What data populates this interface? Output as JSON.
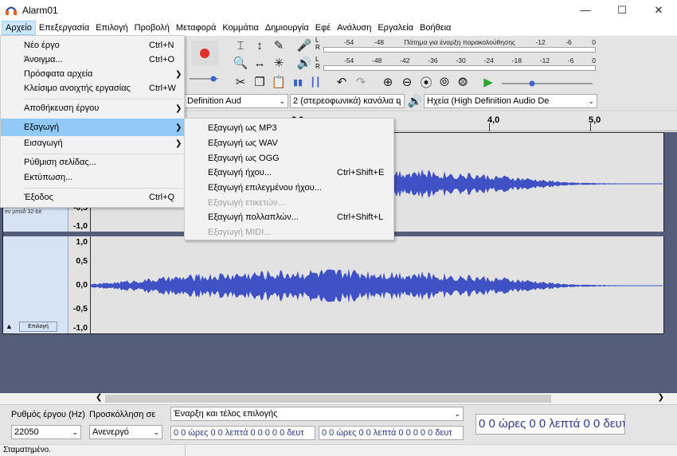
{
  "window": {
    "title": "Alarm01"
  },
  "menubar": [
    "Αρχείο",
    "Επεξεργασία",
    "Επιλογή",
    "Προβολή",
    "Μεταφορά",
    "Κομμάτια",
    "Δημιουργία",
    "Εφέ",
    "Ανάλυση",
    "Εργαλεία",
    "Βοήθεια"
  ],
  "file_menu": [
    {
      "label": "Νέο έργο",
      "shortcut": "Ctrl+N"
    },
    {
      "label": "Άνοιγμα...",
      "shortcut": "Ctrl+O"
    },
    {
      "label": "Πρόσφατα αρχεία",
      "shortcut": "",
      "submenu": true
    },
    {
      "label": "Κλείσιμο ανοιχτής εργασίας",
      "shortcut": "Ctrl+W"
    },
    {
      "label": "Αποθήκευση έργου",
      "shortcut": "",
      "submenu": true
    },
    {
      "label": "Εξαγωγή",
      "shortcut": "",
      "submenu": true
    },
    {
      "label": "Εισαγωγή",
      "shortcut": "",
      "submenu": true
    },
    {
      "label": "Ρύθμιση σελίδας...",
      "shortcut": ""
    },
    {
      "label": "Εκτύπωση...",
      "shortcut": ""
    },
    {
      "label": "Έξοδος",
      "shortcut": "Ctrl+Q"
    }
  ],
  "export_menu": [
    {
      "label": "Εξαγωγή ως MP3",
      "shortcut": "",
      "disabled": false
    },
    {
      "label": "Εξαγωγή ως WAV",
      "shortcut": "",
      "disabled": false
    },
    {
      "label": "Εξαγωγή ως OGG",
      "shortcut": "",
      "disabled": false
    },
    {
      "label": "Εξαγωγή ήχου...",
      "shortcut": "Ctrl+Shift+E",
      "disabled": false
    },
    {
      "label": "Εξαγωγή επιλεγμένου ήχου...",
      "shortcut": "",
      "disabled": false
    },
    {
      "label": "Εξαγωγή ετικετών...",
      "shortcut": "",
      "disabled": true
    },
    {
      "label": "Εξαγωγή πολλαπλών...",
      "shortcut": "Ctrl+Shift+L",
      "disabled": false
    },
    {
      "label": "Εξαγωγή MIDI...",
      "shortcut": "",
      "disabled": true
    }
  ],
  "meters": {
    "record_scale": [
      "-54",
      "-48",
      "Πάτημα για έναρξη παρακολούθησης",
      "-12",
      "-6",
      "0"
    ],
    "playback_scale": [
      "-54",
      "-48",
      "-42",
      "-36",
      "-30",
      "-24",
      "-18",
      "-12",
      "-6",
      "0"
    ],
    "lr": [
      "L",
      "R"
    ]
  },
  "device": {
    "host_partial": "Definition Aud",
    "channels": "2 (στερεοφωνικά) κανάλια η",
    "output": "Ηχεία (High Definition Audio De"
  },
  "ruler": [
    "3,0",
    "4,0",
    "5,0"
  ],
  "track": {
    "info": "ev µmsδ 32-bit",
    "select_label": "Επιλογή",
    "scale_top": [
      "-0,5",
      "-1,0"
    ],
    "scale_bottom": [
      "1,0",
      "0,5",
      "0,0",
      "-0,5",
      "-1,0"
    ]
  },
  "selection_toolbar": {
    "rate_label": "Ρυθμός έργου (Hz)",
    "rate_value": "22050",
    "snap_label": "Προσκόλληση σε",
    "snap_value": "Ανενεργό",
    "selection_mode": "Έναρξη και τέλος επιλογής",
    "start_time": "0 0 ώρες 0 0 λεπτά 0 0 0 0 0 δευτ",
    "end_time": "0 0 ώρες 0 0 λεπτά 0 0 0 0 0 δευτ",
    "audio_position": "0 0 ώρες 0 0 λεπτά 0 0 δευτ"
  },
  "status": "Σταματημένο."
}
